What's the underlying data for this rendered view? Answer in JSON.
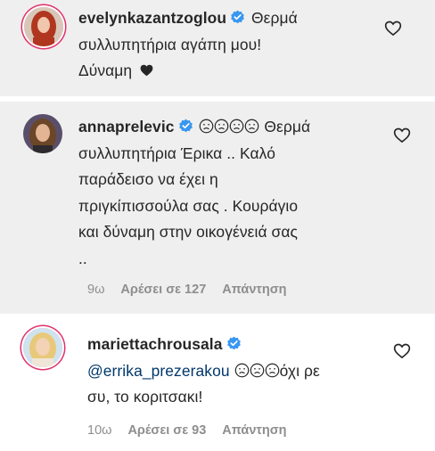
{
  "comments": [
    {
      "username": "evelynkazantzoglou",
      "lines": [
        "Θερμά",
        "συλλυπητήρια αγάπη μου!",
        "Δύναμη"
      ],
      "trailing_icon": "black-heart-icon"
    },
    {
      "username": "annaprelevic",
      "emoji_count": 4,
      "lines": [
        "Θερμά",
        "συλλυπητήρια Έρικα .. Καλό",
        "παράδεισο να έχει η",
        "πριγκίπισσούλα σας . Κουράγιο",
        "και δύναμη στην οικογένειά σας",
        ".."
      ],
      "time": "9ω",
      "likes": "Αρέσει σε 127",
      "reply": "Απάντηση"
    },
    {
      "username": "mariettachrousala",
      "mention": "@errika_prezerakou",
      "emoji_count": 3,
      "lines": [
        "όχι ρε",
        "συ, το κοριτσακι!"
      ],
      "time": "10ω",
      "likes": "Αρέσει σε 93",
      "reply": "Απάντηση"
    }
  ],
  "colors": {
    "highlight_band": "#efefef",
    "verified_badge": "#3897f0",
    "mention": "#00376b",
    "meta": "#8e8e8e"
  }
}
